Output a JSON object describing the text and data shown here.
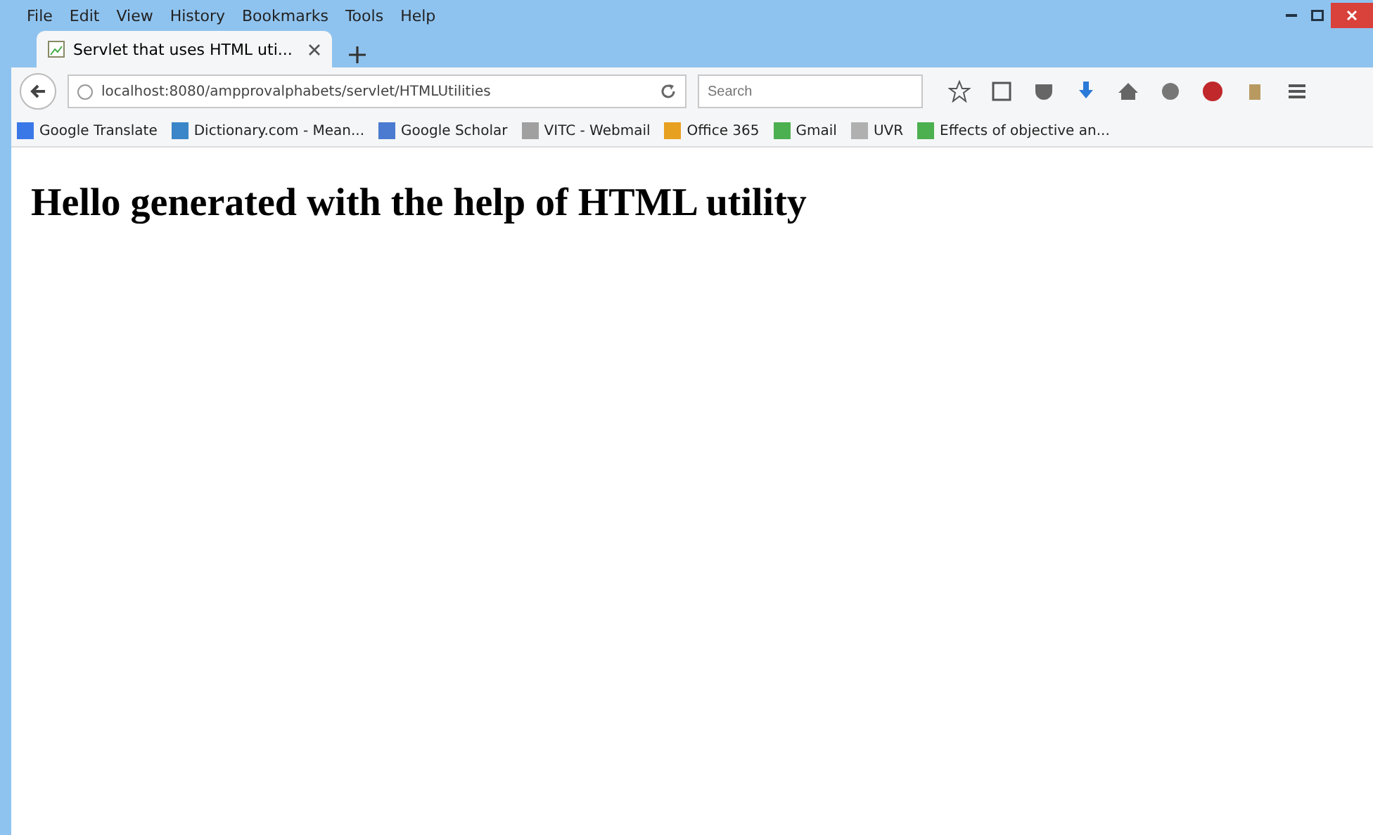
{
  "menu": [
    "File",
    "Edit",
    "View",
    "History",
    "Bookmarks",
    "Tools",
    "Help"
  ],
  "tabs": [
    {
      "label": "Servlet that uses HTML uti...",
      "selected": true
    }
  ],
  "address": {
    "value": "localhost:8080/ampprovalphabets/servlet/HTMLUtilities"
  },
  "search": {
    "placeholder": "Search"
  },
  "bookmarks": [
    {
      "label": "Google Translate",
      "color": "#3b78e7"
    },
    {
      "label": "Dictionary.com - Mean...",
      "color": "#3a86c8"
    },
    {
      "label": "Google Scholar",
      "color": "#4a7bd0"
    },
    {
      "label": "VITC - Webmail",
      "color": "#a0a0a0"
    },
    {
      "label": "Office 365",
      "color": "#e8a020"
    },
    {
      "label": "Gmail",
      "color": "#4caf50"
    },
    {
      "label": "UVR",
      "color": "#b0b0b0"
    },
    {
      "label": "Effects of objective an...",
      "color": "#4caf50"
    }
  ],
  "page": {
    "heading": "Hello generated with the help of HTML utility"
  }
}
